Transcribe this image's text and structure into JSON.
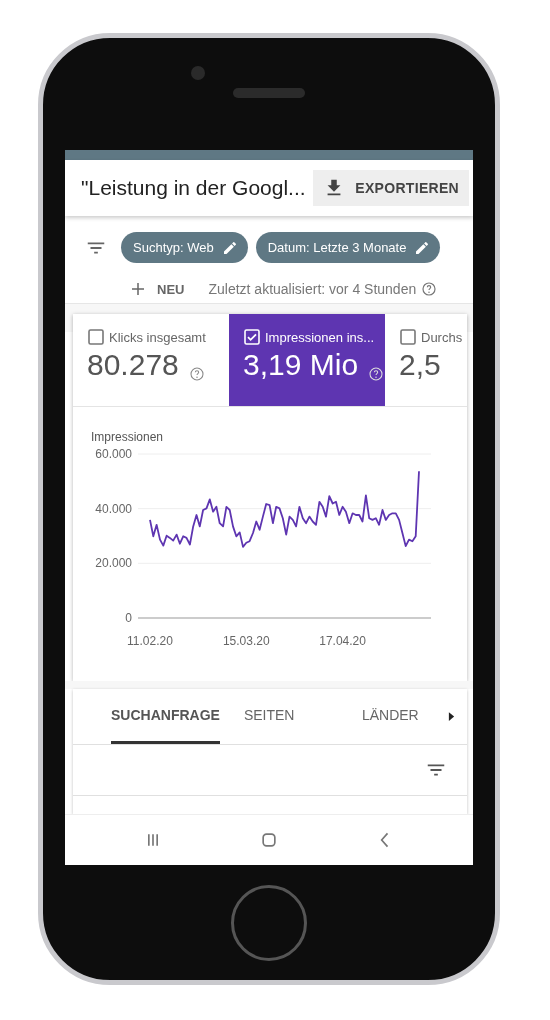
{
  "header": {
    "title": "\"Leistung in der Googl...",
    "export_button": "EXPORTIEREN"
  },
  "filters": [
    {
      "label": "Suchtyp: Web"
    },
    {
      "label": "Datum: Letzte 3 Monate"
    }
  ],
  "new_button": "NEU",
  "updated": "Zuletzt aktualisiert: vor 4 Stunden",
  "metrics": [
    {
      "label": "Klicks insgesamt",
      "value": "80.278",
      "selected": false,
      "help": true
    },
    {
      "label": "Impressionen ins...",
      "value": "3,19 Mio",
      "selected": true,
      "help": true
    },
    {
      "label": "Durchs",
      "value": "2,5",
      "selected": false,
      "help": false
    }
  ],
  "chart": {
    "chart_data": {
      "type": "line",
      "ylabel": "Impressionen",
      "ylim": [
        0,
        60000
      ],
      "yticks": [
        {
          "value": 0,
          "label": "0"
        },
        {
          "value": 20000,
          "label": "20.000"
        },
        {
          "value": 40000,
          "label": "40.000"
        },
        {
          "value": 60000,
          "label": "60.000"
        }
      ],
      "categories": [
        "11.02.20",
        null,
        null,
        null,
        null,
        null,
        null,
        null,
        null,
        null,
        null,
        null,
        null,
        null,
        null,
        null,
        null,
        null,
        null,
        null,
        null,
        null,
        null,
        null,
        null,
        null,
        null,
        null,
        null,
        "15.03.20",
        null,
        null,
        null,
        null,
        null,
        null,
        null,
        null,
        null,
        null,
        null,
        null,
        null,
        null,
        null,
        null,
        null,
        null,
        null,
        null,
        null,
        null,
        null,
        null,
        null,
        null,
        null,
        null,
        "17.04.20",
        null,
        null,
        null,
        null,
        null,
        null,
        null,
        null,
        null,
        null,
        null,
        null,
        null,
        null,
        null,
        null,
        null,
        null,
        null,
        null,
        null,
        null,
        null
      ],
      "series": [
        {
          "color": "#5e35b1",
          "values": [
            35900,
            29900,
            34100,
            28700,
            26500,
            30100,
            29300,
            28300,
            30500,
            27200,
            29900,
            29300,
            26900,
            33500,
            37700,
            33500,
            39500,
            40100,
            43400,
            38900,
            40700,
            34700,
            33500,
            40700,
            39500,
            33500,
            29900,
            31300,
            26000,
            27500,
            28100,
            31100,
            35300,
            32300,
            37100,
            41700,
            41300,
            34700,
            40700,
            40100,
            36500,
            30500,
            37100,
            35900,
            33500,
            40700,
            36500,
            34700,
            37100,
            35300,
            34100,
            42500,
            40700,
            37100,
            44600,
            41900,
            42500,
            37700,
            40700,
            38900,
            34700,
            38300,
            37700,
            37700,
            35300,
            44900,
            36500,
            35900,
            36500,
            34100,
            39500,
            35900,
            37700,
            38300,
            38300,
            35900,
            31100,
            26300,
            28700,
            28100,
            29900,
            53700
          ]
        }
      ]
    }
  },
  "tabs": [
    {
      "label": "SUCHANFRAGE",
      "selected": true
    },
    {
      "label": "SEITEN",
      "selected": false
    },
    {
      "label": "LÄNDER",
      "selected": false
    }
  ]
}
